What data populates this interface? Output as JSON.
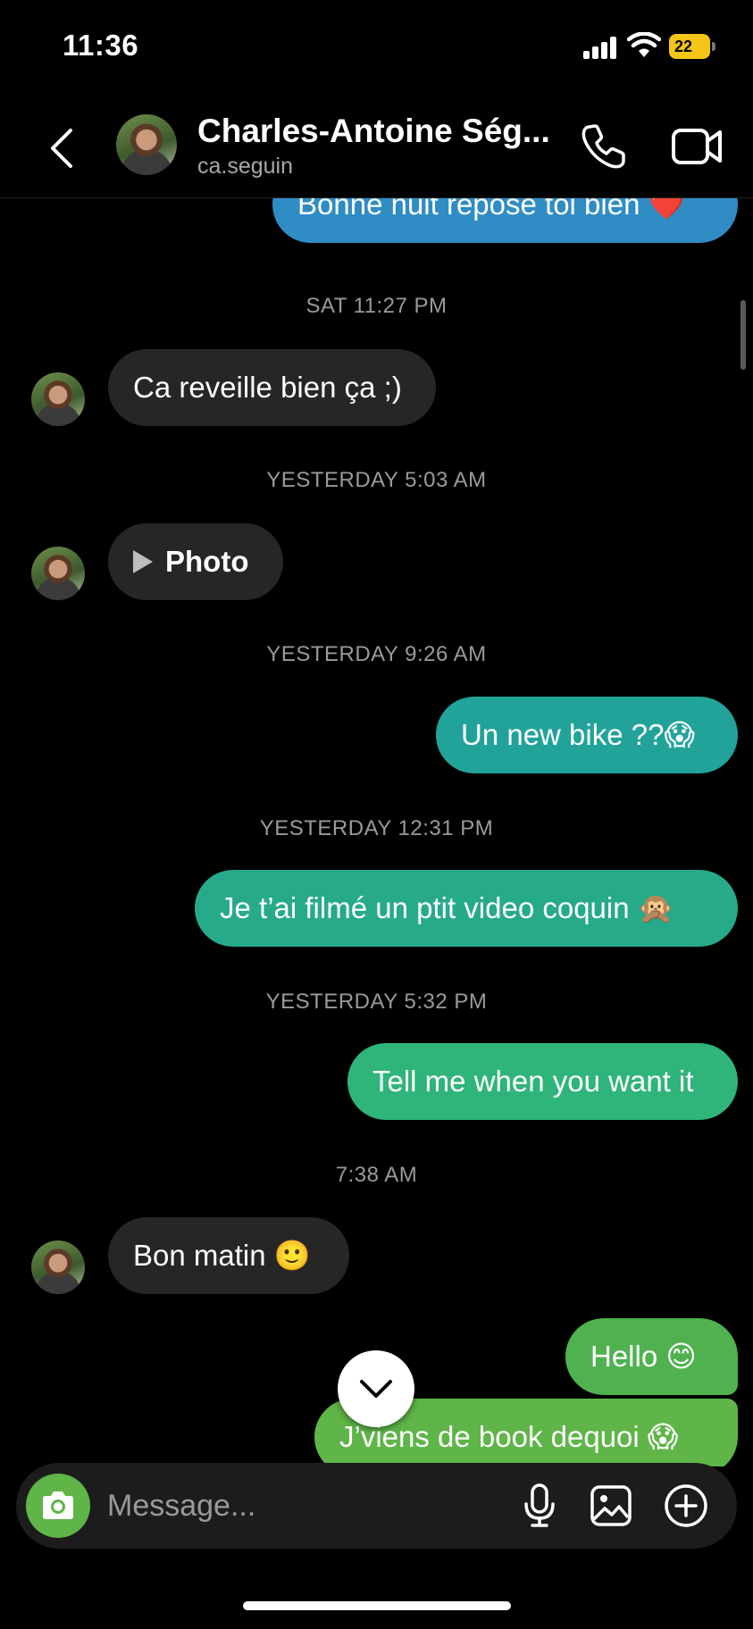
{
  "status_bar": {
    "time": "11:36",
    "battery": "22"
  },
  "header": {
    "name": "Charles-Antoine Ség...",
    "handle": "ca.seguin"
  },
  "messages": {
    "m0": {
      "text": "Bonne nuit repose toi bien ❤️"
    },
    "t1": "SAT 11:27 PM",
    "m1": {
      "text": "Ca reveille bien ça ;)"
    },
    "t2": "YESTERDAY 5:03 AM",
    "m2": {
      "text": "Photo"
    },
    "t3": "YESTERDAY 9:26 AM",
    "m3": {
      "text": "Un new bike ??😱"
    },
    "t4": "YESTERDAY 12:31 PM",
    "m4": {
      "text": "Je t’ai filmé un ptit video coquin 🙊"
    },
    "t5": "YESTERDAY 5:32 PM",
    "m5": {
      "text": "Tell me when you want it"
    },
    "t6": "7:38 AM",
    "m6": {
      "text": "Bon matin 🙂"
    },
    "m7": {
      "text": "Hello 😊"
    },
    "m8": {
      "text": "J’viens de book dequoi 😱"
    }
  },
  "composer": {
    "placeholder": "Message..."
  },
  "colors": {
    "incoming": "#262626",
    "outgoing_blue": "#2f8cc4",
    "outgoing_teal": "#21a39a",
    "outgoing_green": "#2fb47a",
    "outgoing_lime": "#5fb548",
    "camera": "#5fb548"
  },
  "icons": {
    "back": "chevron-left-icon",
    "call": "phone-icon",
    "video": "video-camera-icon",
    "camera": "camera-icon",
    "mic": "microphone-icon",
    "gallery": "image-icon",
    "plus": "plus-circle-icon",
    "scroll": "chevron-down-icon",
    "play": "play-icon"
  }
}
